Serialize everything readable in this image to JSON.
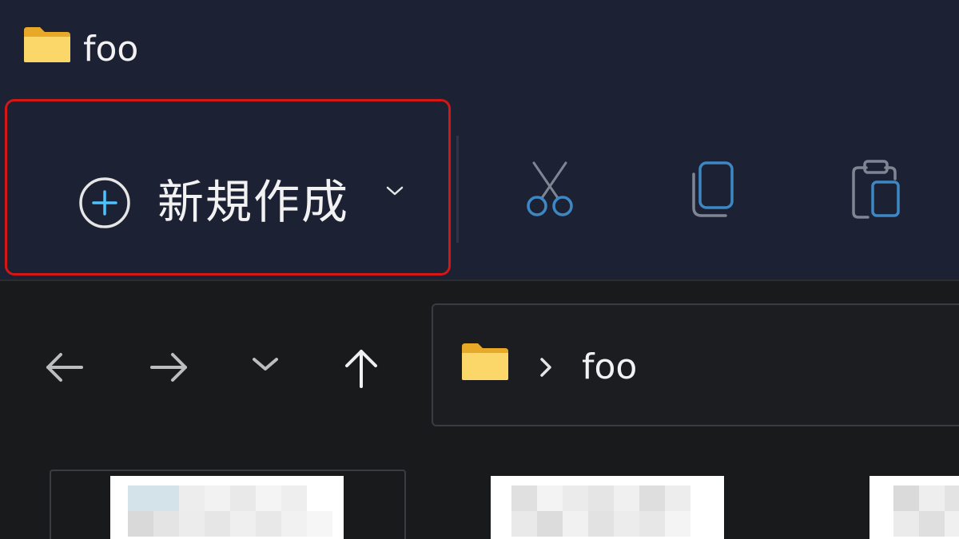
{
  "window": {
    "title": "foo"
  },
  "ribbon": {
    "new_label": "新規作成"
  },
  "address_bar": {
    "path_segment": "foo",
    "separator": "›"
  },
  "icons": {
    "title_folder": "folder-icon",
    "new": "plus-circle-icon",
    "dropdown": "chevron-down-icon",
    "cut": "scissors-icon",
    "copy": "copy-icon",
    "paste": "paste-icon",
    "back": "arrow-left-icon",
    "forward": "arrow-right-icon",
    "recent": "chevron-down-icon",
    "up": "arrow-up-icon"
  },
  "colors": {
    "ribbon_bg": "#1c2133",
    "window_bg": "#191a1c",
    "highlight": "#d41616",
    "accent": "#4cc2ff",
    "folder": "#f8cf5a"
  }
}
